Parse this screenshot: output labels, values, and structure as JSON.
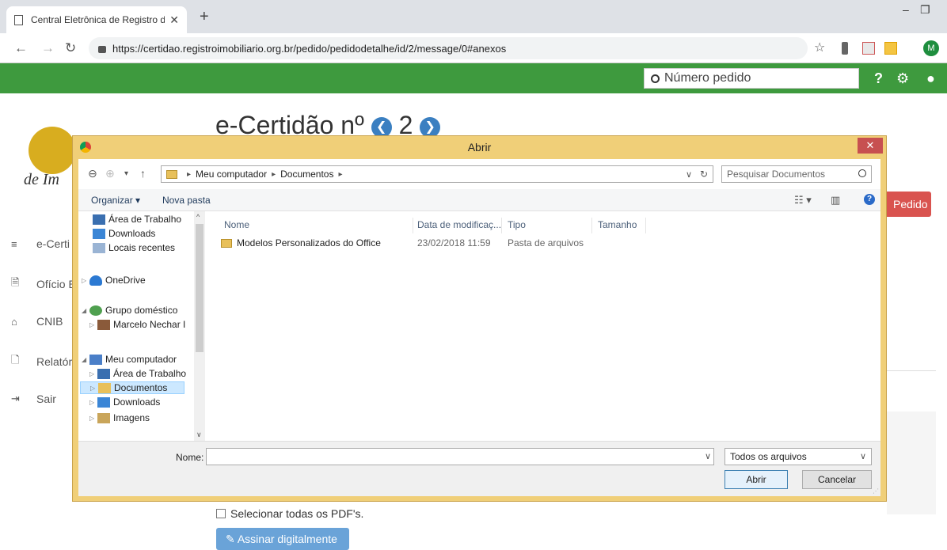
{
  "browser": {
    "tab_title": "Central Eletrônica de Registro de",
    "tab_close": "✕",
    "new_tab": "+",
    "url": "https://certidao.registroimobiliario.org.br/pedido/pedidodetalhe/id/2/message/0#anexos",
    "avatar_letter": "M",
    "minimize": "–",
    "restore": "❐"
  },
  "site": {
    "search_placeholder": "Número pedido",
    "logo_text": "de Im",
    "page_title": "e-Certidão nº",
    "order_number": "2",
    "pedido_button": "Pedido",
    "sidebar": [
      {
        "icon": "≡",
        "label": "e-Certi"
      },
      {
        "icon": "🗎",
        "label": "Ofício E"
      },
      {
        "icon": "⌂",
        "label": "CNIB"
      },
      {
        "icon": "🗋",
        "label": "Relatór"
      },
      {
        "icon": "⇥",
        "label": "Sair"
      }
    ],
    "select_all_label": "Selecionar todas os PDF's.",
    "sign_button": "✎ Assinar digitalmente"
  },
  "dialog": {
    "title": "Abrir",
    "close": "✕",
    "breadcrumb": [
      "Meu computador",
      "Documentos"
    ],
    "search_placeholder": "Pesquisar Documentos",
    "organizar": "Organizar ▾",
    "nova_pasta": "Nova pasta",
    "tree": {
      "desktop_fav": "Área de Trabalho",
      "downloads_fav": "Downloads",
      "recent": "Locais recentes",
      "onedrive": "OneDrive",
      "homegroup": "Grupo doméstico",
      "user": "Marcelo Nechar I",
      "computer": "Meu computador",
      "desktop": "Área de Trabalho",
      "documents": "Documentos",
      "downloads": "Downloads",
      "images": "Imagens"
    },
    "columns": {
      "name": "Nome",
      "modified": "Data de modificaç...",
      "type": "Tipo",
      "size": "Tamanho"
    },
    "files": [
      {
        "name": "Modelos Personalizados do Office",
        "modified": "23/02/2018 11:59",
        "type": "Pasta de arquivos",
        "size": ""
      }
    ],
    "name_label": "Nome:",
    "name_value": "",
    "file_type": "Todos os arquivos",
    "open_button": "Abrir",
    "cancel_button": "Cancelar"
  },
  "colors": {
    "header_green": "#3e9a3e",
    "dialog_frame": "#f0cf78",
    "pedido_red": "#d9534f",
    "sign_blue": "#6aa3d8"
  }
}
